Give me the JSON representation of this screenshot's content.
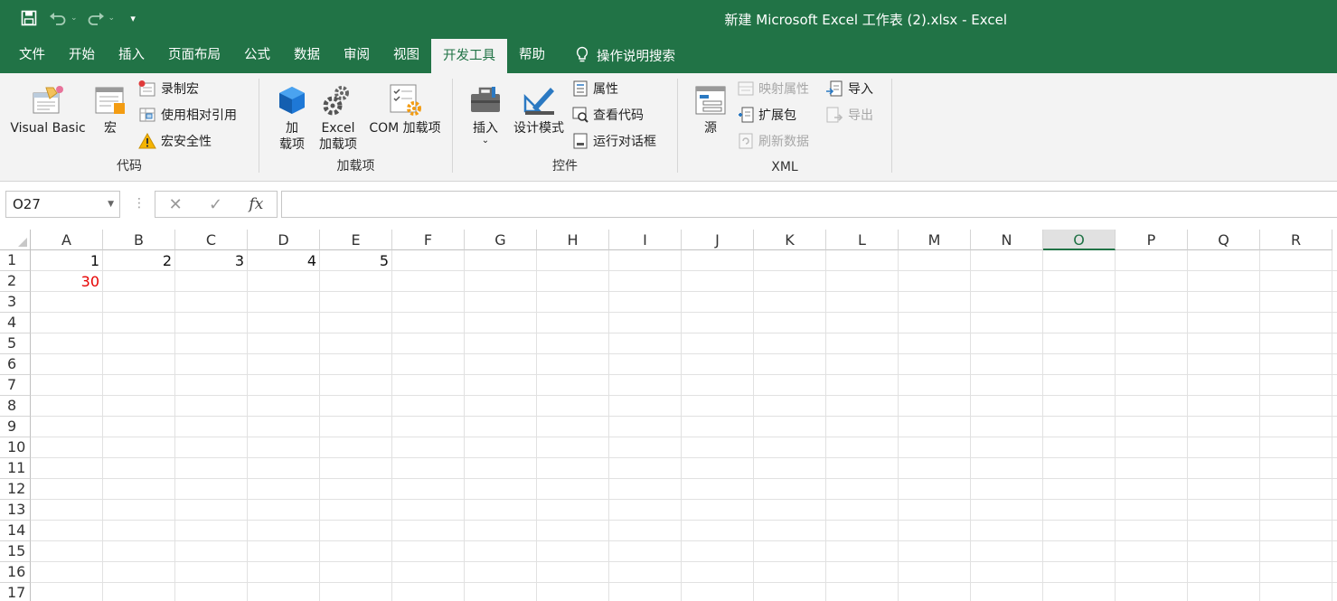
{
  "title": "新建 Microsoft Excel 工作表 (2).xlsx  -  Excel",
  "qat": {
    "save": "save-icon",
    "undo": "undo-icon",
    "redo": "redo-icon",
    "customize": "▾"
  },
  "tabs": [
    {
      "label": "文件",
      "active": false
    },
    {
      "label": "开始",
      "active": false
    },
    {
      "label": "插入",
      "active": false
    },
    {
      "label": "页面布局",
      "active": false
    },
    {
      "label": "公式",
      "active": false
    },
    {
      "label": "数据",
      "active": false
    },
    {
      "label": "审阅",
      "active": false
    },
    {
      "label": "视图",
      "active": false
    },
    {
      "label": "开发工具",
      "active": true
    },
    {
      "label": "帮助",
      "active": false
    }
  ],
  "tell_me": "操作说明搜索",
  "ribbon": {
    "code": {
      "label": "代码",
      "visual_basic": "Visual Basic",
      "macro": "宏",
      "record_macro": "录制宏",
      "relative_ref": "使用相对引用",
      "macro_security": "宏安全性"
    },
    "addins": {
      "label": "加载项",
      "addins_line1": "加",
      "addins_line2": "载项",
      "excel_addins_line1": "Excel",
      "excel_addins_line2": "加载项",
      "com_addins": "COM 加载项"
    },
    "controls": {
      "label": "控件",
      "insert": "插入",
      "insert_dd": "⌄",
      "design_mode": "设计模式",
      "properties": "属性",
      "view_code": "查看代码",
      "run_dialog": "运行对话框"
    },
    "xml": {
      "label": "XML",
      "source": "源",
      "map_properties": "映射属性",
      "expansion_packs": "扩展包",
      "refresh_data": "刷新数据",
      "import": "导入",
      "export": "导出"
    }
  },
  "formula_bar": {
    "name_box": "O27",
    "formula": ""
  },
  "sheet": {
    "columns": [
      "A",
      "B",
      "C",
      "D",
      "E",
      "F",
      "G",
      "H",
      "I",
      "J",
      "K",
      "L",
      "M",
      "N",
      "O",
      "P",
      "Q",
      "R"
    ],
    "selected_column": "O",
    "rows": [
      "1",
      "2",
      "3",
      "4",
      "5",
      "6",
      "7",
      "8",
      "9",
      "10",
      "11",
      "12",
      "13",
      "14",
      "15",
      "16",
      "17"
    ],
    "cells": {
      "A1": "1",
      "B1": "2",
      "C1": "3",
      "D1": "4",
      "E1": "5",
      "A2": "30"
    },
    "red_text_color": "#e60000"
  }
}
